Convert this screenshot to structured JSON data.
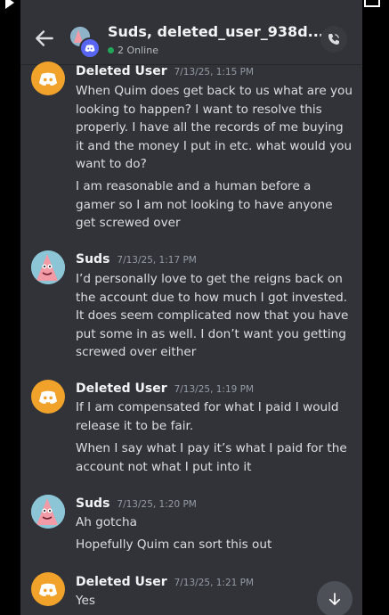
{
  "header": {
    "title": "Suds, deleted_user_938d...",
    "status": "2 Online"
  },
  "messages": [
    {
      "author": "Deleted User",
      "time": "7/13/25, 1:15 PM",
      "avatar": "discord-logo",
      "lines": [
        "When Quim does get back to us what are you looking to happen? I want to resolve this properly. I have all the records of me buying it and the money I put in etc. what would you want to do?",
        "I am reasonable and a human before a gamer so I am not looking to have anyone get screwed over"
      ]
    },
    {
      "author": "Suds",
      "time": "7/13/25, 1:17 PM",
      "avatar": "patrick-star",
      "lines": [
        "I’d personally love to get the reigns back on the account due to how much I got invested. It does seem complicated now that you have put some in as well. I don’t want you getting screwed over either"
      ]
    },
    {
      "author": "Deleted User",
      "time": "7/13/25, 1:19 PM",
      "avatar": "discord-logo",
      "lines": [
        "If I am compensated for what I paid I would release it to be fair.",
        "When I say what I pay it’s what I paid for the account not what I put into it"
      ]
    },
    {
      "author": "Suds",
      "time": "7/13/25, 1:20 PM",
      "avatar": "patrick-star",
      "lines": [
        "Ah gotcha",
        "Hopefully Quim can sort this out"
      ]
    },
    {
      "author": "Deleted User",
      "time": "7/13/25, 1:21 PM",
      "avatar": "discord-logo",
      "lines": [
        "Yes"
      ]
    }
  ],
  "icons": {
    "back": "arrow-left-icon",
    "call": "phone-icon",
    "scroll": "arrow-down-icon"
  },
  "colors": {
    "background": "#313338",
    "online": "#23a55a",
    "discord_avatar": "#f0a22a",
    "blurple": "#5865f2"
  }
}
